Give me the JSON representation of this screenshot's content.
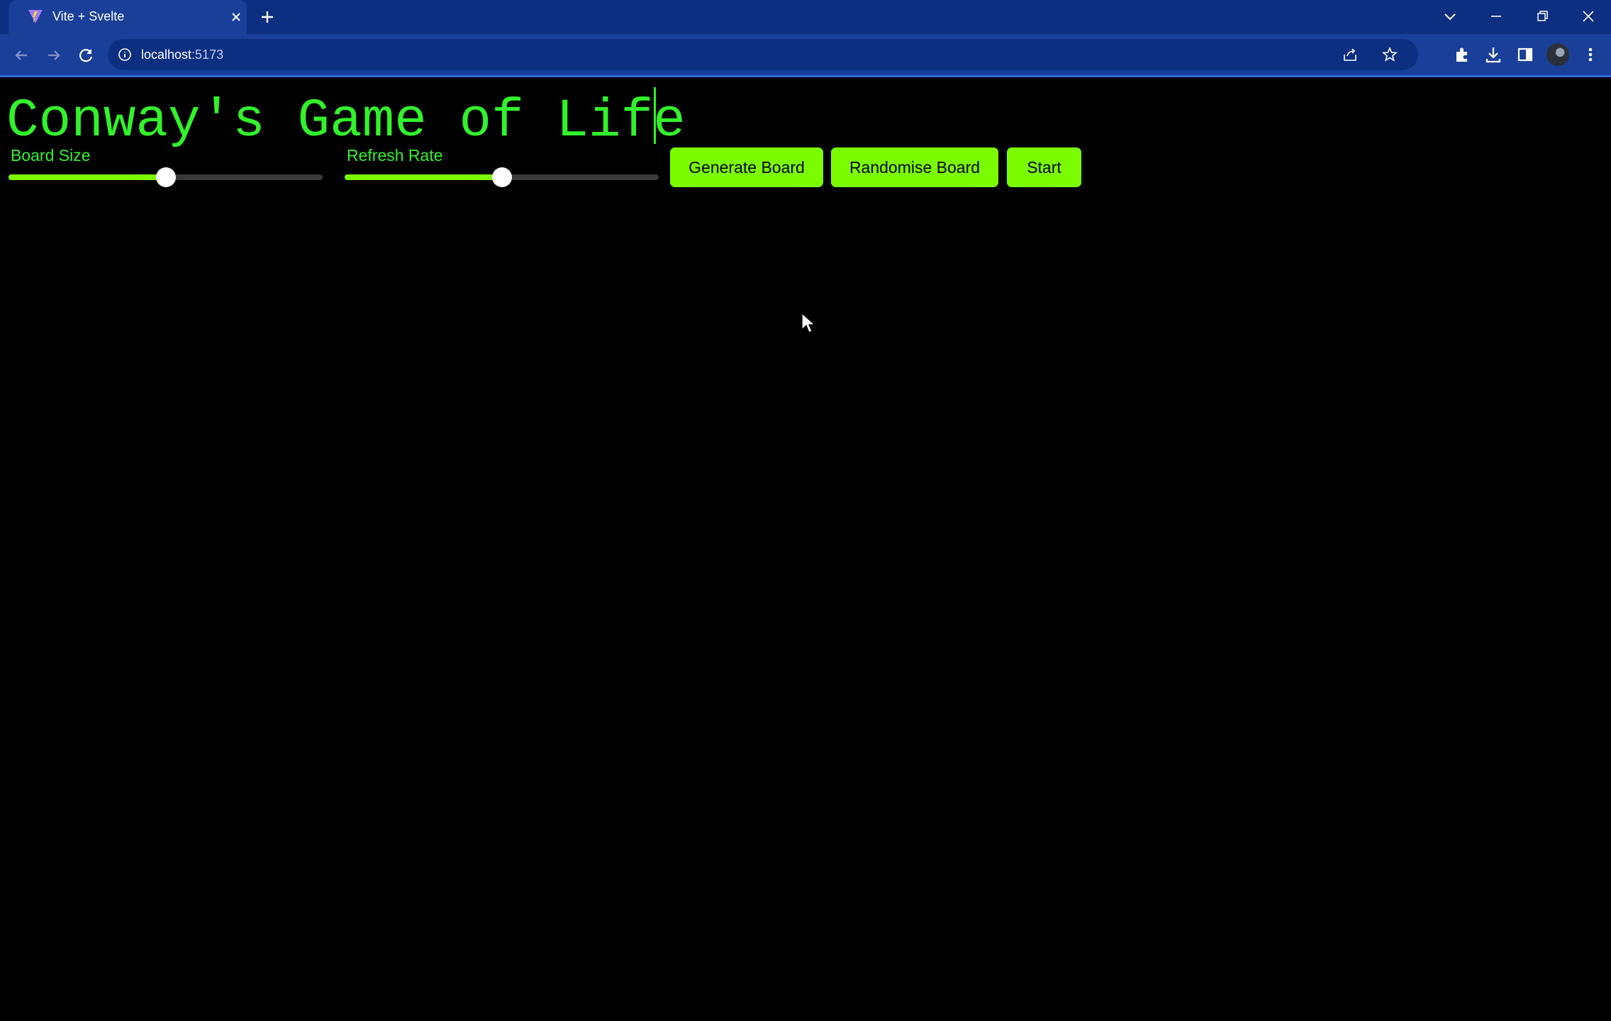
{
  "browser": {
    "tab_title": "Vite + Svelte",
    "url_host": "localhost",
    "url_port": ":5173"
  },
  "page": {
    "title": "Conway's Game of Life",
    "sliders": [
      {
        "label": "Board Size",
        "value_fraction": 0.5
      },
      {
        "label": "Refresh Rate",
        "value_fraction": 0.5
      }
    ],
    "buttons": {
      "generate": "Generate Board",
      "randomise": "Randomise Board",
      "start": "Start"
    }
  },
  "colors": {
    "accent_green": "#7cfc00",
    "title_green": "#32f22b",
    "background": "#000000",
    "browser_frame": "#1a3f99"
  }
}
